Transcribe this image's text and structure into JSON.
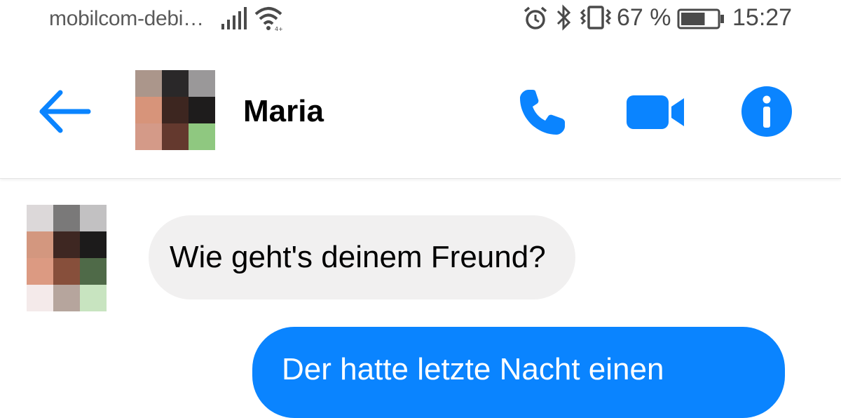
{
  "status_bar": {
    "carrier": "mobilcom-debi…",
    "signal_icon": "signal-bars-icon",
    "wifi_icon": "wifi-icon",
    "alarm_icon": "alarm-icon",
    "bluetooth_icon": "bluetooth-icon",
    "vibrate_icon": "vibrate-icon",
    "battery_percent": "67 %",
    "battery_level": 0.67,
    "time": "15:27"
  },
  "header": {
    "back_icon": "arrow-left-icon",
    "contact_name": "Maria",
    "avatar": "pixelated-avatar",
    "actions": {
      "call_icon": "phone-icon",
      "video_icon": "video-camera-icon",
      "info_icon": "info-icon"
    }
  },
  "messages": [
    {
      "direction": "received",
      "text": "Wie geht's deinem Freund?"
    },
    {
      "direction": "sent",
      "text": "Der hatte letzte Nacht einen"
    }
  ],
  "colors": {
    "accent": "#0a84ff",
    "received_bubble": "#f1f0f0",
    "sent_text": "#ffffff"
  }
}
